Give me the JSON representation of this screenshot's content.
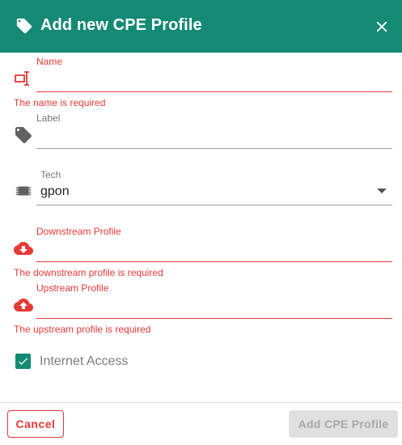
{
  "dialog": {
    "title": "Add new CPE Profile",
    "icon": "tag-icon",
    "close_icon": "close-icon",
    "accent_color": "#148a74"
  },
  "fields": {
    "name": {
      "label": "Name",
      "value": "",
      "error": "The name is required",
      "icon": "input-cursor-icon"
    },
    "label": {
      "label": "Label",
      "value": "",
      "icon": "tag-icon"
    },
    "tech": {
      "label": "Tech",
      "value": "gpon",
      "icon": "chip-icon"
    },
    "downstream": {
      "label": "Downstream Profile",
      "value": "",
      "error": "The downstream profile is required",
      "icon": "cloud-download-icon"
    },
    "upstream": {
      "label": "Upstream Profile",
      "value": "",
      "error": "The upstream profile is required",
      "icon": "cloud-upload-icon"
    }
  },
  "internet_access": {
    "label": "Internet Access",
    "checked": true
  },
  "footer": {
    "cancel_label": "Cancel",
    "add_label": "Add CPE Profile"
  },
  "colors": {
    "error": "#e53935",
    "disabled_bg": "#e0e0e0"
  }
}
